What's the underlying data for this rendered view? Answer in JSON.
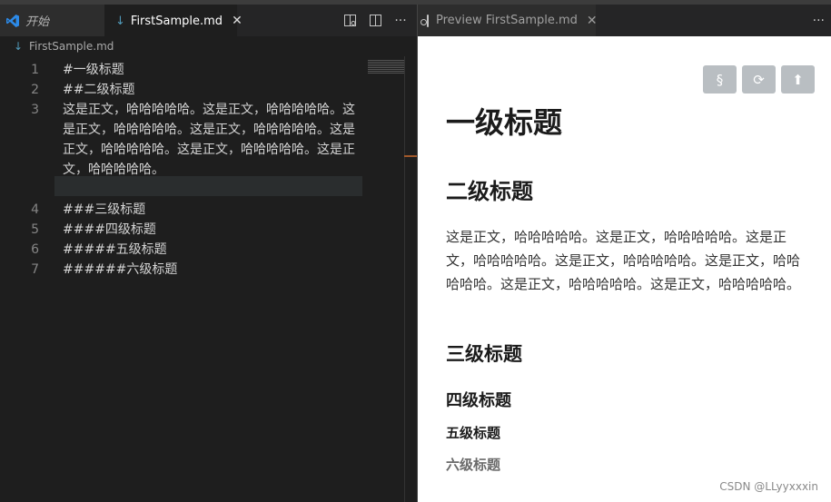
{
  "tabs": {
    "start_label": "开始",
    "file_label": "FirstSample.md",
    "close_glyph": "✕"
  },
  "editor": {
    "breadcrumb": "FirstSample.md",
    "lines": [
      {
        "no": "1",
        "text": "#一级标题"
      },
      {
        "no": "2",
        "text": "##二级标题"
      },
      {
        "no": "3",
        "text": "这是正文，哈哈哈哈哈。这是正文，哈哈哈哈哈。这是正文，哈哈哈哈哈。这是正文，哈哈哈哈哈。这是正文，哈哈哈哈哈。这是正文，哈哈哈哈哈。这是正文，哈哈哈哈哈。"
      },
      {
        "no": "4",
        "text": "###三级标题"
      },
      {
        "no": "5",
        "text": "####四级标题"
      },
      {
        "no": "6",
        "text": "#####五级标题"
      },
      {
        "no": "7",
        "text": "######六级标题"
      }
    ]
  },
  "preview": {
    "tab_label": "Preview FirstSample.md",
    "h1": "一级标题",
    "h2": "二级标题",
    "paragraph": "这是正文，哈哈哈哈哈。这是正文，哈哈哈哈哈。这是正文，哈哈哈哈哈。这是正文，哈哈哈哈哈。这是正文，哈哈哈哈哈。这是正文，哈哈哈哈哈。这是正文，哈哈哈哈哈。",
    "h3": "三级标题",
    "h4": "四级标题",
    "h5": "五级标题",
    "h6": "六级标题",
    "buttons": {
      "toc": "§",
      "refresh": "⟳",
      "top": "⬆"
    }
  },
  "watermark": "CSDN @LLyyxxxin",
  "colors": {
    "editor_bg": "#1e1e1e",
    "tab_bar": "#252526",
    "preview_bg": "#ffffff",
    "vscode_blue": "#2c8ae8"
  }
}
